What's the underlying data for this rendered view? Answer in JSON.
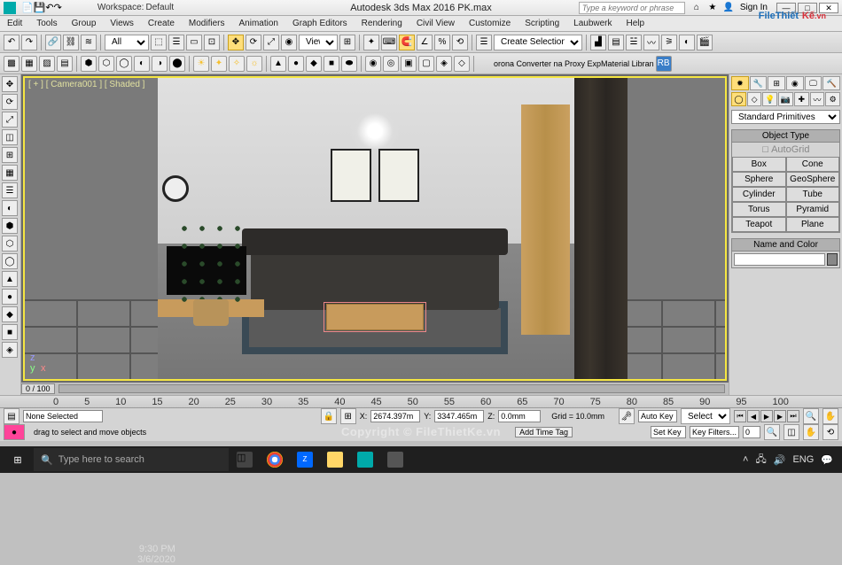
{
  "titlebar": {
    "workspace_label": "Workspace:",
    "workspace_value": "Default",
    "app_title": "Autodesk 3ds Max 2016   PK.max",
    "search_placeholder": "Type a keyword or phrase",
    "signin": "Sign In",
    "win_min": "—",
    "win_max": "□",
    "win_close": "✕"
  },
  "menubar": {
    "items": [
      "Edit",
      "Tools",
      "Group",
      "Views",
      "Create",
      "Modifiers",
      "Animation",
      "Graph Editors",
      "Rendering",
      "Civil View",
      "Customize",
      "Scripting",
      "Laubwerk",
      "Help"
    ]
  },
  "toolbar1": {
    "filter_dropdown": "All",
    "view_dropdown": "View",
    "selset_dropdown": "Create Selection Se"
  },
  "toolbar2": {
    "corona_label": "orona Converter na Proxy ExpMaterial Libran",
    "rb": "RB"
  },
  "viewport": {
    "label": "[ + ] [ Camera001 ] [ Shaded ]",
    "axis_x": "x",
    "axis_y": "y",
    "axis_z": "z"
  },
  "rightpanel": {
    "dropdown": "Standard Primitives",
    "object_type_hdr": "Object Type",
    "autogrid": "AutoGrid",
    "buttons": [
      "Box",
      "Cone",
      "Sphere",
      "GeoSphere",
      "Cylinder",
      "Tube",
      "Torus",
      "Pyramid",
      "Teapot",
      "Plane"
    ],
    "name_color_hdr": "Name and Color"
  },
  "timeline": {
    "frame_label": "0 / 100"
  },
  "bottom": {
    "ruler_ticks": [
      "0",
      "5",
      "10",
      "15",
      "20",
      "25",
      "30",
      "35",
      "40",
      "45",
      "50",
      "55",
      "60",
      "65",
      "70",
      "75",
      "80",
      "85",
      "90",
      "95",
      "100"
    ],
    "none_selected": "None Selected",
    "hint": "drag to select and move objects",
    "x_lbl": "X:",
    "x_val": "2674.397m",
    "y_lbl": "Y:",
    "y_val": "3347.465m",
    "z_lbl": "Z:",
    "z_val": "0.0mm",
    "grid": "Grid = 10.0mm",
    "autokey": "Auto Key",
    "setkey": "Set Key",
    "selected": "Selected",
    "keyfilters": "Key Filters...",
    "add_time_tag": "Add Time Tag"
  },
  "watermark": {
    "copy": "Copyright © FileThietKe.vn",
    "logo1": "File",
    "logo2": "Thiết",
    "logo3": "Kế",
    "logo4": ".vn"
  },
  "taskbar": {
    "search_placeholder": "Type here to search",
    "lang": "ENG",
    "time": "9:30 PM",
    "date": "3/6/2020"
  }
}
